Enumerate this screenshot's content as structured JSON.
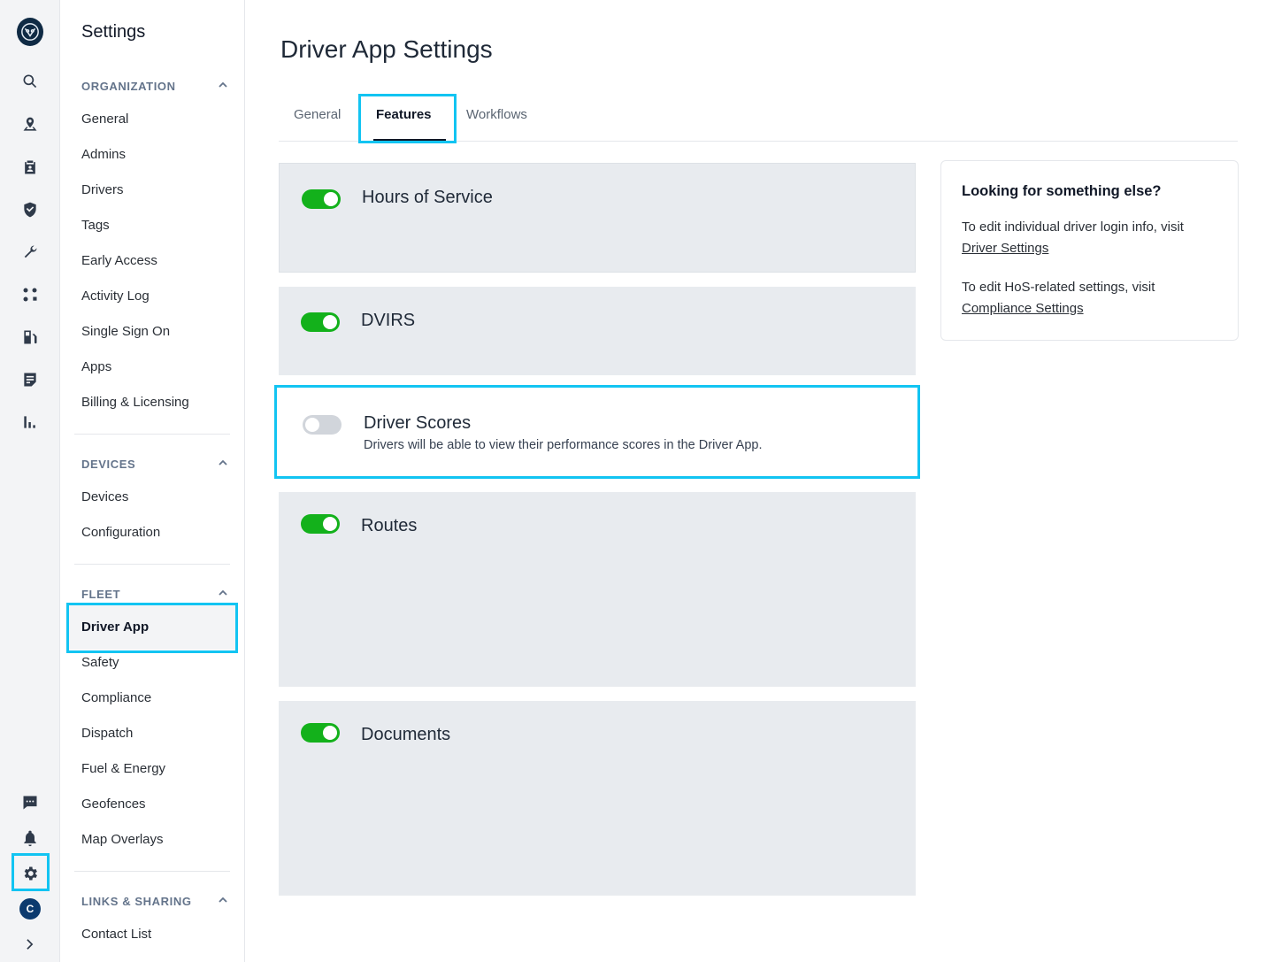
{
  "sidebar": {
    "title": "Settings",
    "sections": [
      {
        "header": "ORGANIZATION",
        "items": [
          "General",
          "Admins",
          "Drivers",
          "Tags",
          "Early Access",
          "Activity Log",
          "Single Sign On",
          "Apps",
          "Billing & Licensing"
        ]
      },
      {
        "header": "DEVICES",
        "items": [
          "Devices",
          "Configuration"
        ]
      },
      {
        "header": "FLEET",
        "items": [
          "Driver App",
          "Safety",
          "Compliance",
          "Dispatch",
          "Fuel & Energy",
          "Geofences",
          "Map Overlays"
        ]
      },
      {
        "header": "LINKS & SHARING",
        "items": [
          "Contact List"
        ]
      }
    ],
    "active_item": "Driver App"
  },
  "rail": {
    "icons": [
      "logo-icon",
      "search-icon",
      "map-pin-icon",
      "clipboard-icon",
      "shield-icon",
      "wrench-icon",
      "routes-icon",
      "fuel-icon",
      "document-icon",
      "bar-chart-icon",
      "chat-icon",
      "bell-icon",
      "gear-icon"
    ],
    "avatar_initial": "C"
  },
  "main": {
    "title": "Driver App Settings",
    "tabs": [
      {
        "label": "General",
        "active": false
      },
      {
        "label": "Features",
        "active": true
      },
      {
        "label": "Workflows",
        "active": false
      }
    ],
    "features": [
      {
        "title": "Hours of Service",
        "enabled": true,
        "description": ""
      },
      {
        "title": "DVIRS",
        "enabled": true,
        "description": ""
      },
      {
        "title": "Driver Scores",
        "enabled": false,
        "description": "Drivers will be able to view their performance scores in the Driver App."
      },
      {
        "title": "Routes",
        "enabled": true,
        "description": ""
      },
      {
        "title": "Documents",
        "enabled": true,
        "description": ""
      }
    ]
  },
  "info_panel": {
    "title": "Looking for something else?",
    "line1": "To edit individual driver login info, visit",
    "link1": "Driver Settings",
    "line2": "To edit HoS-related settings, visit",
    "link2": "Compliance Settings"
  },
  "colors": {
    "accent_highlight": "#12c4f2",
    "toggle_on": "#13b11b",
    "toggle_off": "#d1d5db",
    "card_bg": "#e8ebef"
  }
}
